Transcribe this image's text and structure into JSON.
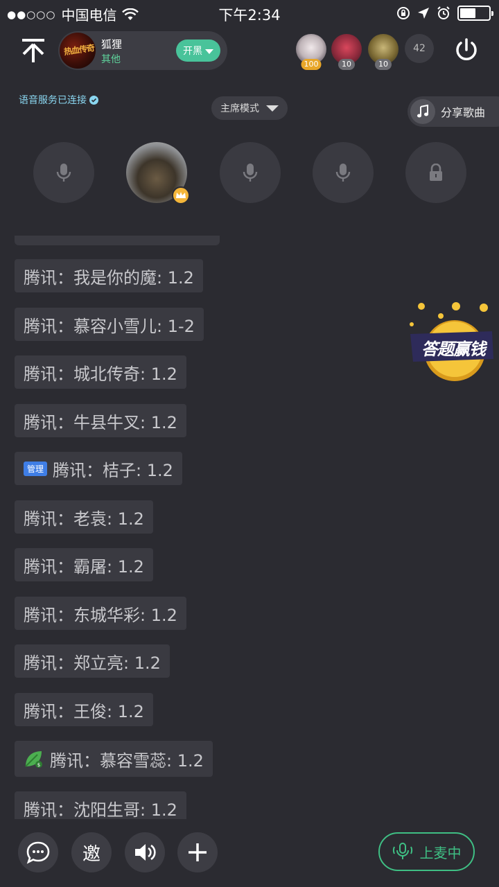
{
  "status_bar": {
    "signal": "●●○○○",
    "carrier": "中国电信",
    "time": "下午2:34",
    "battery_level": 0.55
  },
  "header": {
    "room_name": "狐狸",
    "room_category": "其他",
    "room_avatar_text": "热血传奇",
    "start_button": "开黑",
    "fans": [
      {
        "badge": "100",
        "badge_color": "#e8a628",
        "color": "#d8d2d6"
      },
      {
        "badge": "10",
        "badge_color": "#6c6c72",
        "color": "#a8334a"
      },
      {
        "badge": "10",
        "badge_color": "#6c6c72",
        "color": "#8a7a3a"
      }
    ],
    "online_count": "42"
  },
  "voice_status": "语音服务已连接",
  "mode": "主席模式",
  "share_song": "分享歌曲",
  "seats": [
    {
      "type": "mic"
    },
    {
      "type": "host"
    },
    {
      "type": "mic"
    },
    {
      "type": "mic"
    },
    {
      "type": "locked"
    }
  ],
  "chat": [
    {
      "text": "腾讯：我是你的魔: 1.2"
    },
    {
      "text": "腾讯：慕容小雪儿: 1-2"
    },
    {
      "text": "腾讯：城北传奇: 1.2"
    },
    {
      "text": "腾讯：牛县牛叉: 1.2"
    },
    {
      "tag": "管理",
      "text": "腾讯：桔子: 1.2"
    },
    {
      "text": "腾讯：老袁: 1.2"
    },
    {
      "text": "腾讯：霸屠: 1.2"
    },
    {
      "text": "腾讯：东城华彩: 1.2"
    },
    {
      "text": "腾讯：郑立亮: 1.2"
    },
    {
      "text": "腾讯：王俊: 1.2"
    },
    {
      "icon": "leaf-money-icon",
      "text": "腾讯：慕容雪蕊: 1.2"
    },
    {
      "text": "腾讯：沈阳生哥: 1.2"
    }
  ],
  "promo": {
    "text": "答题赢钱",
    "accent": "#f5c53a"
  },
  "bottom_bar": {
    "invite_label": "邀",
    "mic_button_label": "上麦中",
    "accent_color": "#3fbf84"
  }
}
